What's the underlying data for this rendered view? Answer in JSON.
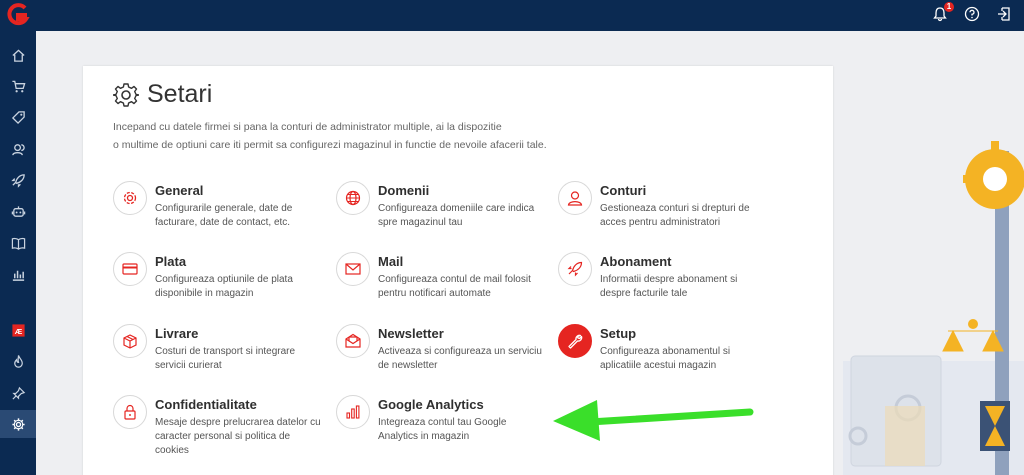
{
  "colors": {
    "brand": "#e52521",
    "nav": "#0b2a52",
    "arrow": "#3adf2a"
  },
  "topbar": {
    "notification_count": "1"
  },
  "sidebar": {
    "items": [
      {
        "icon": "home-icon"
      },
      {
        "icon": "cart-icon"
      },
      {
        "icon": "tag-icon"
      },
      {
        "icon": "customers-icon"
      },
      {
        "icon": "rocket-icon"
      },
      {
        "icon": "robot-icon"
      },
      {
        "icon": "book-icon"
      },
      {
        "icon": "chart-icon"
      },
      {
        "icon": "ae-icon"
      },
      {
        "icon": "fire-icon"
      },
      {
        "icon": "pin-icon"
      },
      {
        "icon": "gear-icon"
      }
    ]
  },
  "page": {
    "title": "Setari",
    "intro_line1": "Incepand cu datele firmei si pana la conturi de administrator multiple, ai la dispozitie",
    "intro_line2": "o multime de optiuni care iti permit sa configurezi magazinul in functie de nevoile afacerii tale."
  },
  "settings": [
    {
      "title": "General",
      "desc": "Configurarile generale, date de facturare, date de contact, etc."
    },
    {
      "title": "Domenii",
      "desc": "Configureaza domeniile care indica spre magazinul tau"
    },
    {
      "title": "Conturi",
      "desc": "Gestioneaza conturi si drepturi de acces pentru administratori"
    },
    {
      "title": "Plata",
      "desc": "Configureaza optiunile de plata disponibile in magazin"
    },
    {
      "title": "Mail",
      "desc": "Configureaza contul de mail folosit pentru notificari automate"
    },
    {
      "title": "Abonament",
      "desc": "Informatii despre abonament si despre facturile tale"
    },
    {
      "title": "Livrare",
      "desc": "Costuri de transport si integrare servicii curierat"
    },
    {
      "title": "Newsletter",
      "desc": "Activeaza si configureaza un serviciu de newsletter"
    },
    {
      "title": "Setup",
      "desc": "Configureaza abonamentul si aplicatiile acestui magazin"
    },
    {
      "title": "Confidentialitate",
      "desc": "Mesaje despre prelucrarea datelor cu caracter personal si politica de cookies"
    },
    {
      "title": "Google Analytics",
      "desc": "Integreaza contul tau Google Analytics in magazin"
    }
  ]
}
